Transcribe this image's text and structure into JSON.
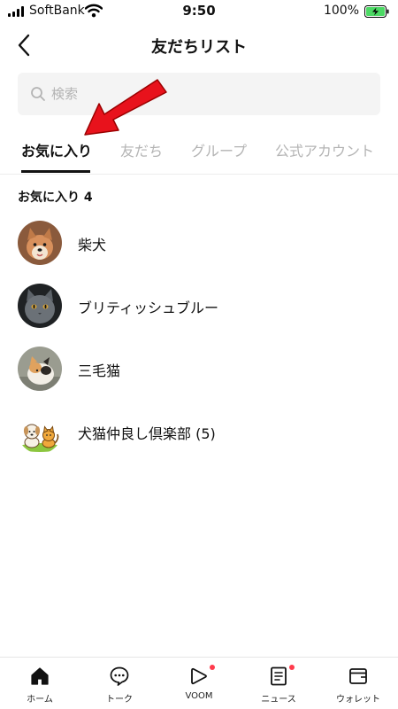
{
  "status_bar": {
    "carrier": "SoftBank",
    "time": "9:50",
    "battery": "100%"
  },
  "header": {
    "title": "友だちリスト"
  },
  "search": {
    "placeholder": "検索",
    "value": ""
  },
  "tabs": [
    {
      "label": "お気に入り",
      "active": true
    },
    {
      "label": "友だち",
      "active": false
    },
    {
      "label": "グループ",
      "active": false
    },
    {
      "label": "公式アカウント",
      "active": false
    }
  ],
  "favorites": {
    "section_title": "お気に入り 4",
    "items": [
      {
        "name": "柴犬",
        "avatar": "shiba-dog-photo"
      },
      {
        "name": "ブリティッシュブルー",
        "avatar": "gray-cat-photo"
      },
      {
        "name": "三毛猫",
        "avatar": "calico-cat-photo"
      },
      {
        "name": "犬猫仲良し倶楽部 (5)",
        "avatar": "dog-and-cat-illustration"
      }
    ]
  },
  "bottom_nav": [
    {
      "label": "ホーム",
      "icon": "home-icon",
      "active": true,
      "badge": false
    },
    {
      "label": "トーク",
      "icon": "chat-icon",
      "active": false,
      "badge": false
    },
    {
      "label": "VOOM",
      "icon": "voom-icon",
      "active": false,
      "badge": true
    },
    {
      "label": "ニュース",
      "icon": "news-icon",
      "active": false,
      "badge": true
    },
    {
      "label": "ウォレット",
      "icon": "wallet-icon",
      "active": false,
      "badge": false
    }
  ],
  "colors": {
    "accent_arrow": "#e8121c",
    "badge": "#ff3b4c",
    "battery_fill": "#4cd964",
    "inactive_tab": "#b4b4b4"
  }
}
